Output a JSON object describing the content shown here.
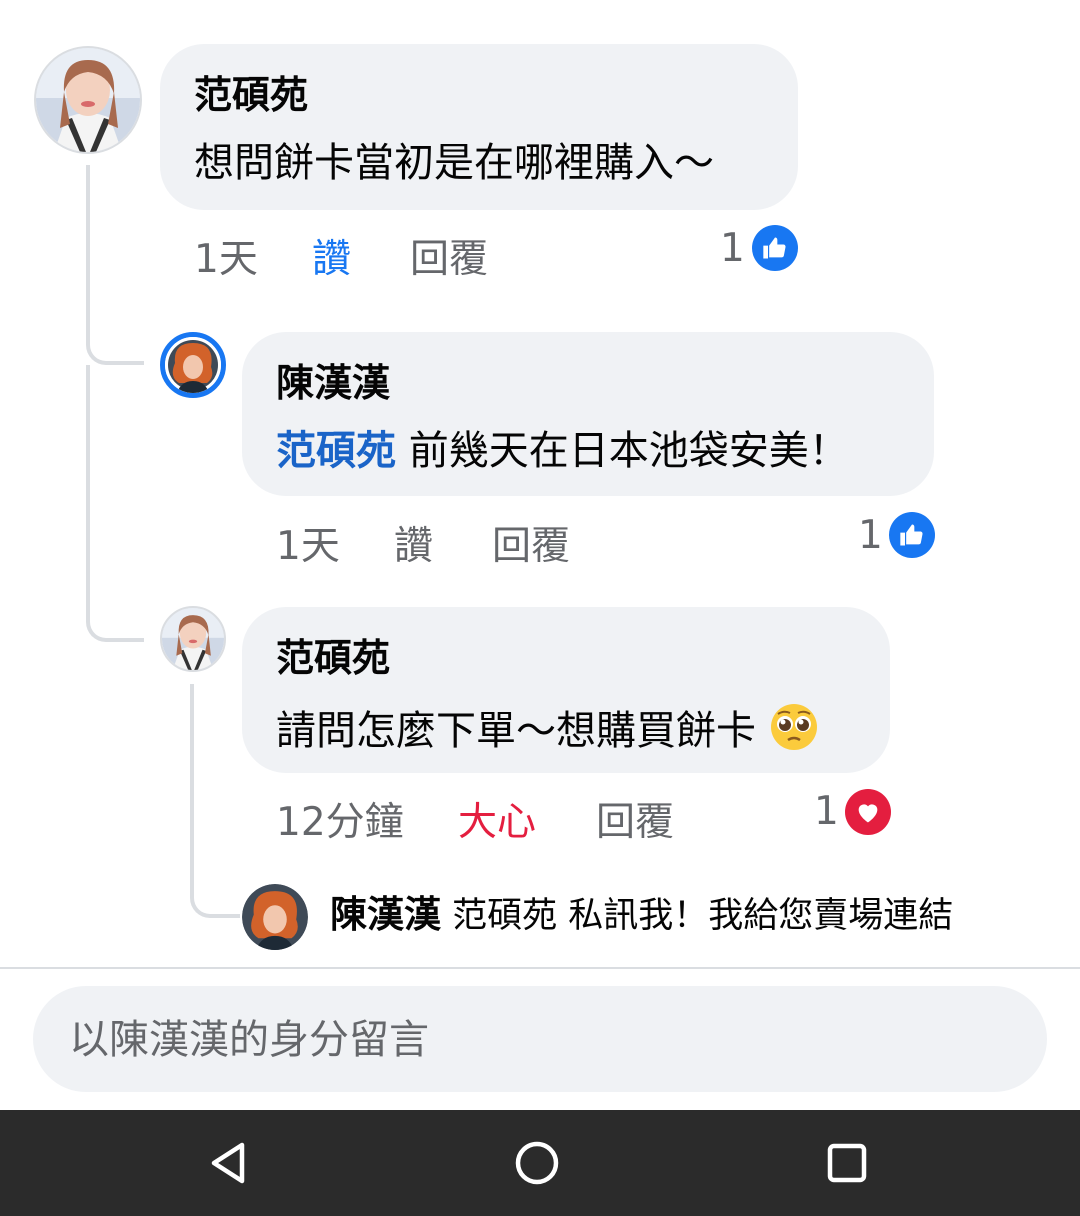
{
  "comments": [
    {
      "author": "范碩苑",
      "text": "想問餅卡當初是在哪裡購入～",
      "time": "1天",
      "like_label": "讚",
      "reply_label": "回覆",
      "reaction_count": "1",
      "reaction_icon": "like-icon"
    },
    {
      "author": "陳漢漢",
      "mention": "范碩苑",
      "text": " 前幾天在日本池袋安美！",
      "time": "1天",
      "like_label": "讚",
      "reply_label": "回覆",
      "reaction_count": "1",
      "reaction_icon": "like-icon"
    },
    {
      "author": "范碩苑",
      "text": "請問怎麼下單～想購買餅卡",
      "emoji": "pleading-face",
      "time": "12分鐘",
      "like_label": "大心",
      "reply_label": "回覆",
      "reaction_count": "1",
      "reaction_icon": "love-icon"
    }
  ],
  "collapsed_reply": {
    "author": "陳漢漢",
    "text": "范碩苑 私訊我！我給您賣場連結"
  },
  "composer": {
    "placeholder": "以陳漢漢的身分留言"
  },
  "navbar": {
    "back_icon": "back-triangle-icon",
    "home_icon": "home-circle-icon",
    "recents_icon": "recents-square-icon"
  },
  "colors": {
    "like_blue": "#1877f2",
    "love_red": "#e41e3f",
    "mention_blue": "#1a64c8",
    "bubble_bg": "#f0f2f5",
    "meta_gray": "#65676b"
  }
}
